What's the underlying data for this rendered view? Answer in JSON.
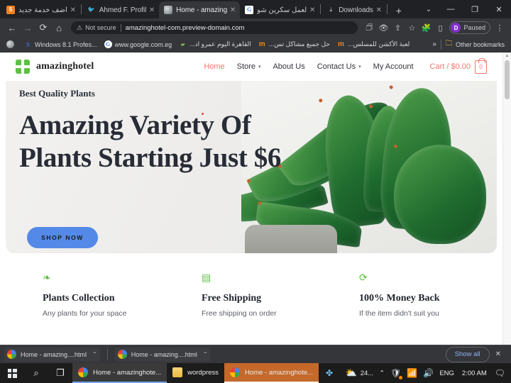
{
  "browser": {
    "tabs": [
      {
        "title": "أضف خدمة جديد",
        "favicon": "orange-5-icon",
        "rtl": true,
        "active": false
      },
      {
        "title": "Ahmed F. Profil",
        "favicon": "twitter-icon",
        "rtl": false,
        "active": false
      },
      {
        "title": "Home - amazing",
        "favicon": "globe-icon",
        "rtl": false,
        "active": true
      },
      {
        "title": "لعمل سكرين شو",
        "favicon": "google-icon",
        "rtl": true,
        "active": false
      },
      {
        "title": "Downloads",
        "favicon": "download-icon",
        "rtl": false,
        "active": false
      }
    ],
    "new_tab_label": "+",
    "tab_close_label": "✕",
    "window_controls": {
      "expand": "⌄",
      "minimize": "—",
      "maximize": "❐",
      "close": "✕"
    },
    "toolbar": {
      "back": "←",
      "forward": "→",
      "reload": "⟳",
      "home": "⌂",
      "security_icon": "warning-triangle-icon",
      "security_label": "Not secure",
      "url": "amazinghotel-com.preview-domain.com",
      "icons": [
        "translate-icon",
        "eye-slash-icon",
        "share-icon",
        "bookmark-star-icon",
        "extensions-puzzle-icon",
        "side-panel-icon"
      ],
      "profile_initial": "D",
      "profile_status": "Paused",
      "menu": "⋮"
    },
    "bookmarks": [
      {
        "label": "",
        "icon": "globe-icon",
        "rtl": false
      },
      {
        "label": "Windows 8.1 Profes...",
        "icon": "skype-s-icon",
        "rtl": false
      },
      {
        "label": "www.google.com.eg",
        "icon": "google-icon",
        "rtl": false
      },
      {
        "label": "القاهرة اليوم عمرو اد...",
        "icon": "green-icon",
        "rtl": true
      },
      {
        "label": "حل جميع مشاكل تس...",
        "icon": "m-icon",
        "rtl": true
      },
      {
        "label": "لعبة الأكشن للمسلس...",
        "icon": "m-icon",
        "rtl": true
      }
    ],
    "bookmarks_overflow": "»",
    "other_bookmarks": {
      "label": "Other bookmarks",
      "icon": "folder-icon"
    }
  },
  "site": {
    "brand_name": "amazinghotel",
    "nav": [
      {
        "label": "Home",
        "active": true,
        "caret": false
      },
      {
        "label": "Store",
        "active": false,
        "caret": true
      },
      {
        "label": "About Us",
        "active": false,
        "caret": false
      },
      {
        "label": "Contact Us",
        "active": false,
        "caret": true
      },
      {
        "label": "My Account",
        "active": false,
        "caret": false
      }
    ],
    "cart": {
      "label": "Cart / $0.00",
      "count": "0"
    },
    "hero": {
      "kicker": "Best Quality Plants",
      "title": "Amazing Variety Of Plants Starting Just $6",
      "cta": "SHOP NOW"
    },
    "features": [
      {
        "icon": "leaf-icon",
        "glyph": "❧",
        "title": "Plants Collection",
        "subtitle": "Any plants for your space"
      },
      {
        "icon": "box-icon",
        "glyph": "▤",
        "title": "Free Shipping",
        "subtitle": "Free shipping on order"
      },
      {
        "icon": "refresh-icon",
        "glyph": "⟳",
        "title": "100% Money Back",
        "subtitle": "If the item didn't suit you"
      }
    ],
    "colors": {
      "accent": "#f8766e",
      "brand_green": "#5cc043",
      "cta_blue": "#5489e8",
      "heading": "#272c36"
    }
  },
  "downloads_bar": {
    "items": [
      {
        "name": "Home - amazing....html",
        "caret": "⌃"
      },
      {
        "name": "Home - amazing....html",
        "caret": "⌃"
      }
    ],
    "show_all": "Show all",
    "close": "✕"
  },
  "taskbar": {
    "start": "windows-logo-icon",
    "search": "⌕",
    "task_view": "❐",
    "apps": [
      {
        "label": "Home - amazinghote...",
        "icon": "chrome-icon",
        "state": "chrome"
      },
      {
        "label": "wordpress",
        "icon": "folder-icon",
        "state": "explorer"
      },
      {
        "label": "Home - amazinghote...",
        "icon": "chrome-icon",
        "state": "active-orange"
      }
    ],
    "extra_icon": "puzzle-icon",
    "tray": {
      "weather_icon": "partly-cloudy-icon",
      "weather_temp": "24...",
      "overflow": "⌃",
      "security_icon": "defender-icon",
      "network_icon": "wifi-icon",
      "volume_icon": "speaker-icon",
      "language": "ENG",
      "clock": "2:00 AM",
      "action_center_icon": "notifications-icon"
    }
  }
}
